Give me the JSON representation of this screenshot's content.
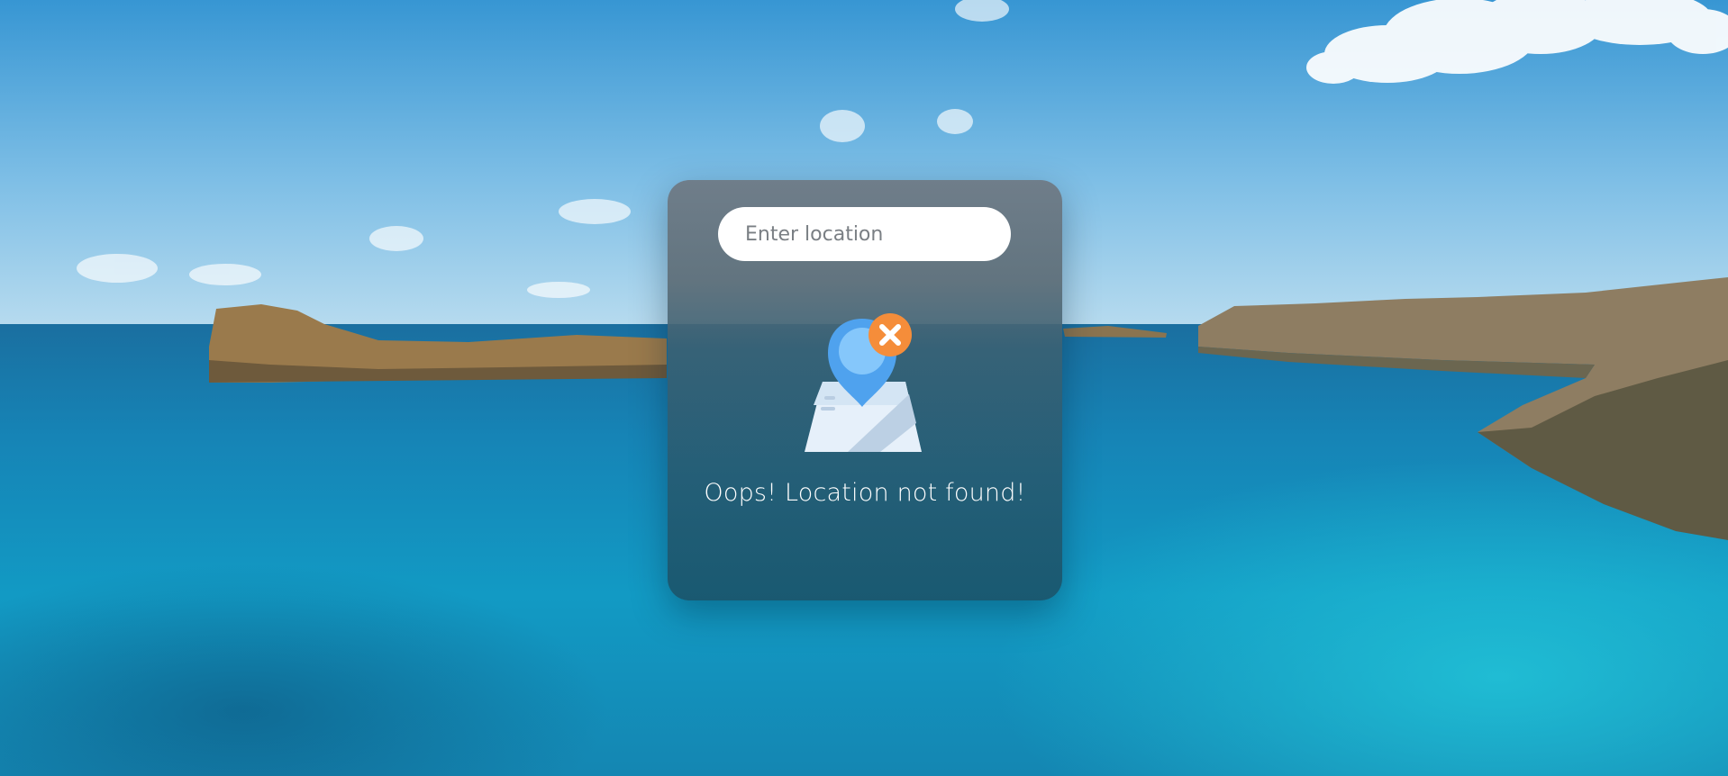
{
  "search": {
    "placeholder": "Enter location",
    "value": ""
  },
  "error": {
    "message": "Oops! Location not found!",
    "icon": "map-pin-error-icon"
  },
  "background": {
    "description_icon": "sea-landscape-background"
  },
  "colors": {
    "sky_top": "#3a9ad8",
    "sea": "#1a8fb8",
    "pin": "#5aaaf0",
    "error_badge": "#f79a45",
    "map_paper": "#e4eef8"
  }
}
